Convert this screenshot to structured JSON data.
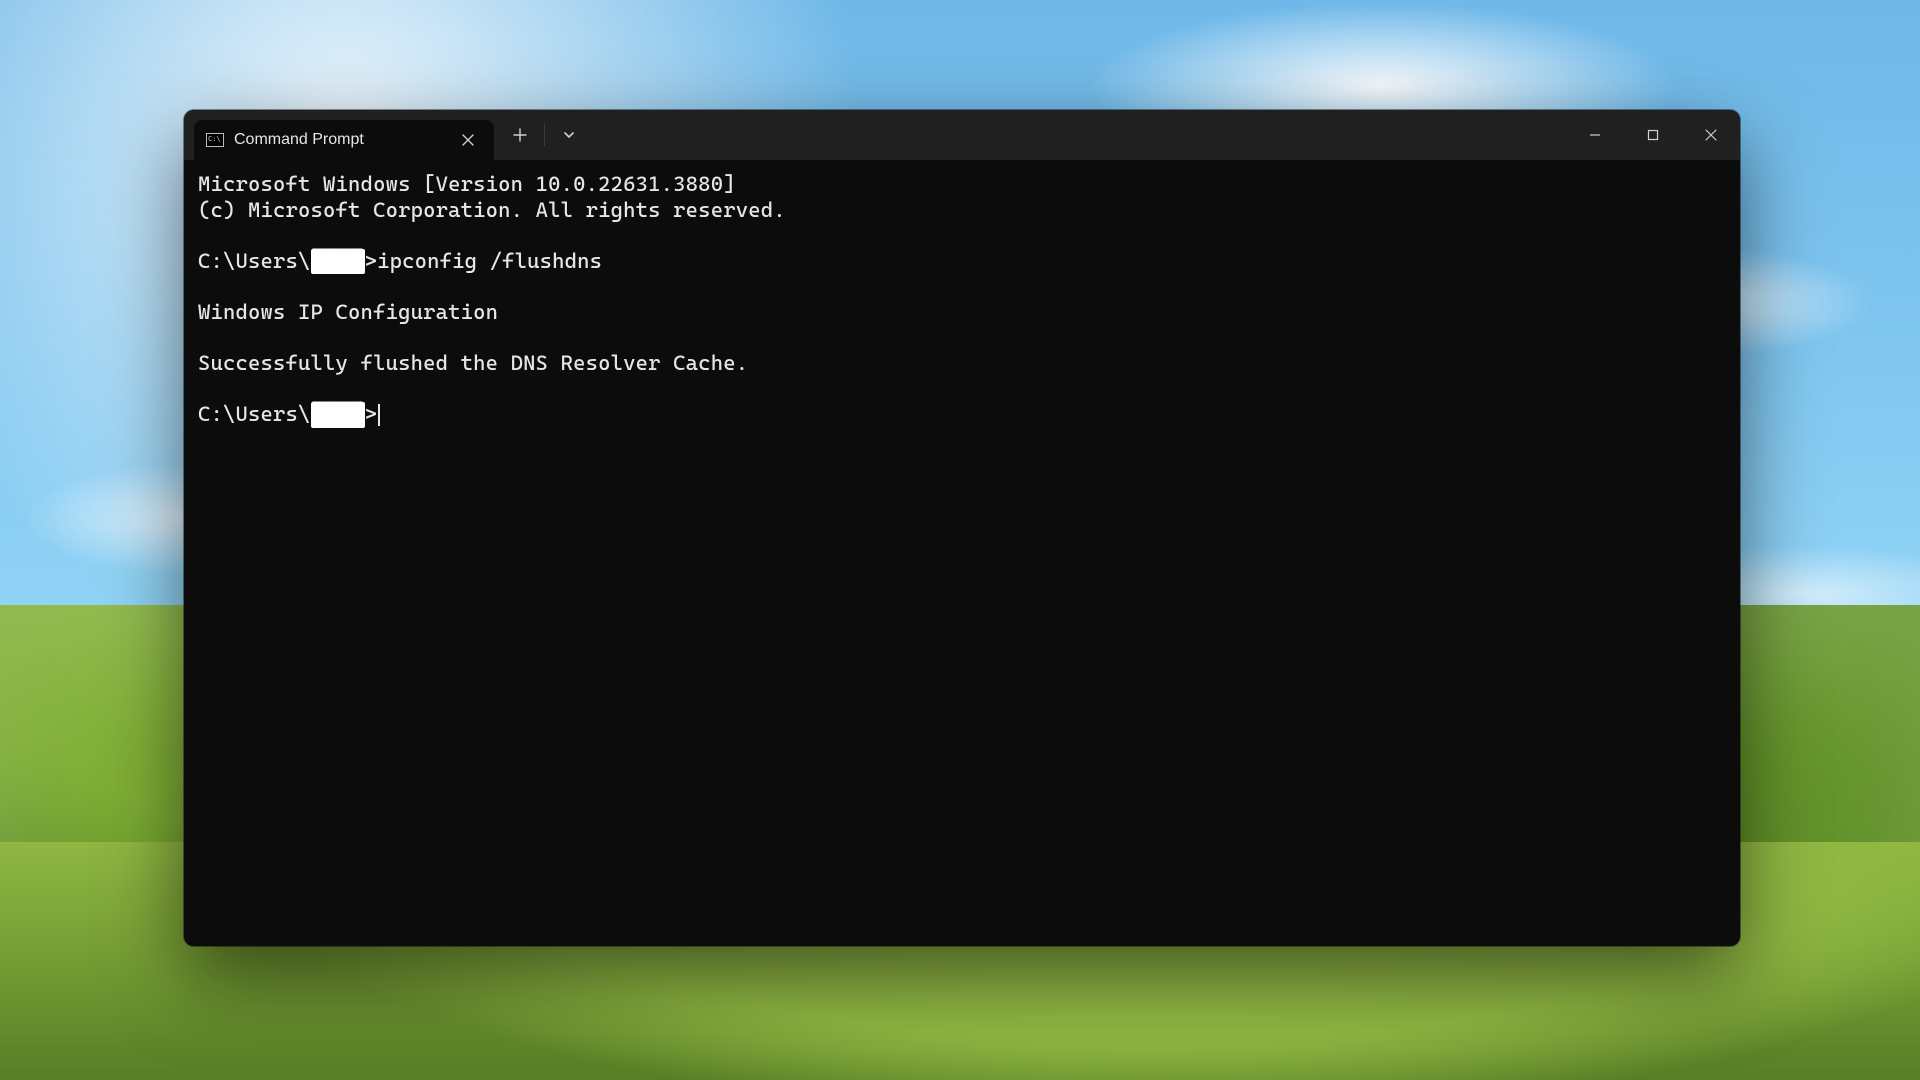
{
  "tab": {
    "title": "Command Prompt"
  },
  "terminal": {
    "banner_line1": "Microsoft Windows [Version 10.0.22631.3880]",
    "banner_line2": "(c) Microsoft Corporation. All rights reserved.",
    "prompt_prefix": "C:\\Users\\",
    "redacted_user": "████",
    "prompt_suffix": ">",
    "command": "ipconfig /flushdns",
    "output_header": "Windows IP Configuration",
    "output_result": "Successfully flushed the DNS Resolver Cache."
  }
}
